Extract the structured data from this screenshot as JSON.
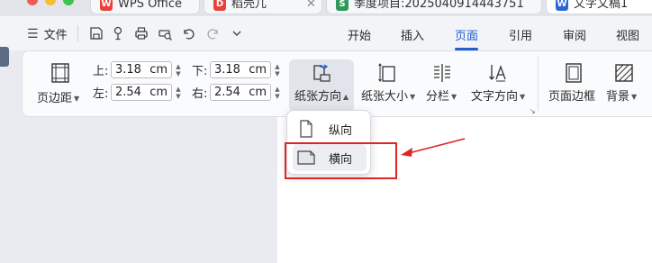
{
  "tabs": [
    {
      "label": "WPS Office",
      "logo": "W",
      "color": "#e8423a"
    },
    {
      "label": "稻壳儿",
      "logo": "D",
      "color": "#e8423a",
      "close": "✕"
    },
    {
      "label": "季度项目:2025040914443751",
      "logo": "S",
      "color": "#2e9a58"
    },
    {
      "label": "文字文稿1",
      "logo": "W",
      "color": "#2b66d9"
    }
  ],
  "menubar": {
    "file_label": "文件",
    "nav": [
      "开始",
      "插入",
      "页面",
      "引用",
      "审阅",
      "视图"
    ],
    "active_nav": "页面"
  },
  "ribbon": {
    "margins_label": "页边距",
    "margins": {
      "top_label": "上:",
      "top_value": "3.18",
      "top_unit": "cm",
      "bottom_label": "下:",
      "bottom_value": "3.18",
      "bottom_unit": "cm",
      "left_label": "左:",
      "left_value": "2.54",
      "left_unit": "cm",
      "right_label": "右:",
      "right_value": "2.54",
      "right_unit": "cm"
    },
    "orientation_label": "纸张方向",
    "size_label": "纸张大小",
    "columns_label": "分栏",
    "text_direction_label": "文字方向",
    "page_border_label": "页面边框",
    "background_label": "背景"
  },
  "orientation_menu": {
    "items": [
      {
        "label": "纵向",
        "icon": "portrait-page-icon",
        "selected": false
      },
      {
        "label": "横向",
        "icon": "landscape-page-icon",
        "selected": true
      }
    ]
  },
  "colors": {
    "accent": "#1f5fd1",
    "annotation": "#e02424"
  }
}
